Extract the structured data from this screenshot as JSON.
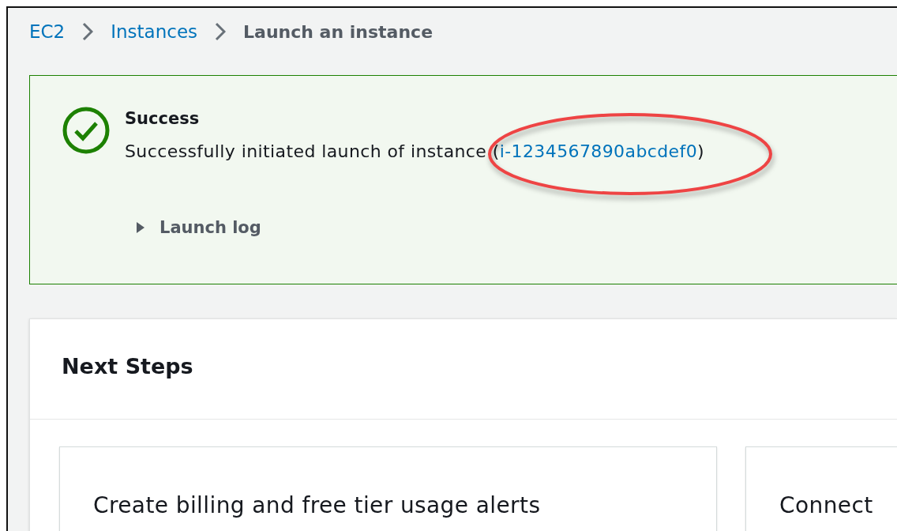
{
  "breadcrumb": [
    {
      "label": "EC2",
      "kind": "link"
    },
    {
      "label": "Instances",
      "kind": "link"
    },
    {
      "label": "Launch an instance",
      "kind": "current"
    }
  ],
  "alert": {
    "title": "Success",
    "message": "Successfully initiated launch of instance (",
    "link": "i-1234567890abcdef0",
    "suffix": ")",
    "expander": {
      "label": "Launch log",
      "expanded": false
    }
  },
  "next_steps": {
    "title": "Next Steps",
    "cards": [
      {
        "title": "Create billing and free tier usage alerts"
      },
      {
        "title": "Connect"
      }
    ]
  }
}
